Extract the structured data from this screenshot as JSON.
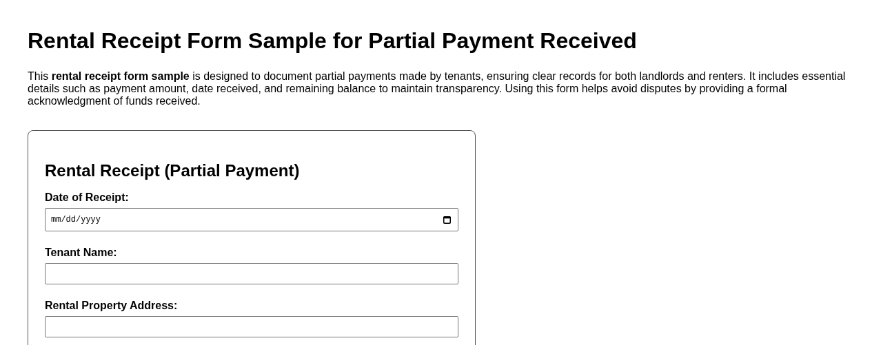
{
  "title": "Rental Receipt Form Sample for Partial Payment Received",
  "intro": "This **rental receipt form sample** is designed to document partial payments made by tenants, ensuring clear records for both landlords and renters. It includes essential details such as payment amount, date received, and remaining balance to maintain transparency. Using this form helps avoid disputes by providing a formal acknowledgment of funds received.",
  "form": {
    "title": "Rental Receipt (Partial Payment)",
    "fields": [
      {
        "label": "Date of Receipt:",
        "kind": "date",
        "placeholder": "mm/dd/yyyy"
      },
      {
        "label": "Tenant Name:",
        "kind": "text"
      },
      {
        "label": "Rental Property Address:",
        "kind": "text"
      }
    ]
  }
}
